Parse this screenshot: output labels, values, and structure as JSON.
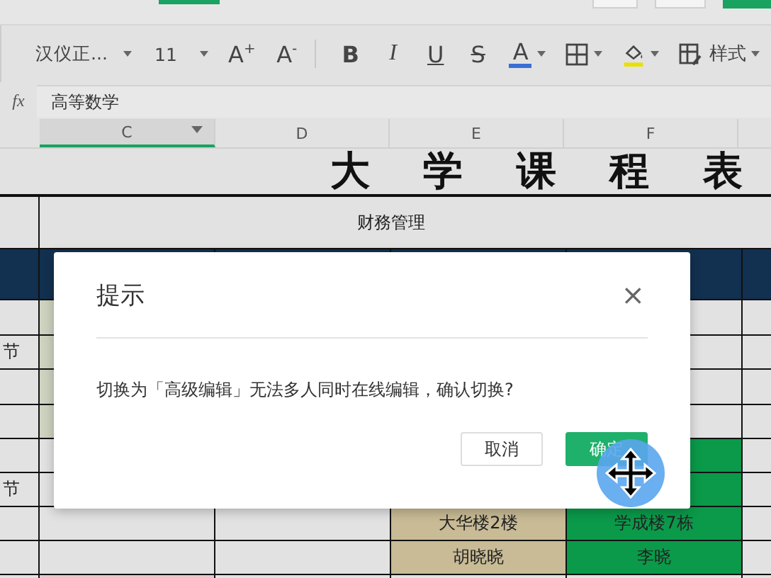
{
  "toolbar": [
    {
      "kind": "font",
      "label": "汉仪正..."
    },
    {
      "kind": "size",
      "label": "11"
    },
    {
      "kind": "grow",
      "label": "A$^{+}$"
    },
    {
      "kind": "shrink",
      "label": "A$^{-}$"
    },
    {
      "kind": "bold",
      "label": "B"
    },
    {
      "kind": "italic",
      "label": "I"
    },
    {
      "kind": "underline",
      "label": "U"
    },
    {
      "kind": "strike",
      "label": "S"
    },
    {
      "kind": "font-color",
      "label": "A",
      "color": "#3b6fd6"
    },
    {
      "kind": "borders"
    },
    {
      "kind": "fill",
      "color": "#e8e000"
    },
    {
      "kind": "styles",
      "label": "样式"
    }
  ],
  "formula_bar": {
    "label": "fx",
    "value": "高等数学"
  },
  "columns": [
    {
      "label": "C",
      "selected": true
    },
    {
      "label": "D",
      "selected": false
    },
    {
      "label": "E",
      "selected": false
    },
    {
      "label": "F",
      "selected": false
    }
  ],
  "sheet": {
    "title": "大 学 课 程 表",
    "subtitle": "财務管理",
    "rows": [
      {
        "cells": [
          {
            "color": "#12304f"
          },
          {
            "color": "#12304f"
          },
          {
            "color": "#12304f"
          },
          {
            "color": "#12304f"
          },
          {
            "color": "#12304f"
          },
          {
            "color": "#12304f"
          }
        ]
      },
      {
        "cells": [
          {},
          {
            "color": "#cdd3bf"
          },
          {},
          {},
          {},
          {}
        ]
      },
      {
        "cells": [
          {
            "text": "节"
          },
          {
            "color": "#cdd3bf"
          },
          {},
          {},
          {},
          {}
        ]
      },
      {
        "cells": [
          {},
          {
            "color": "#cdd3bf"
          },
          {},
          {},
          {},
          {}
        ]
      },
      {
        "cells": [
          {},
          {
            "color": "#cdd3bf"
          },
          {},
          {},
          {},
          {}
        ]
      },
      {
        "cells": [
          {},
          {},
          {},
          {},
          {
            "color": "#0a9a4a"
          },
          {}
        ]
      },
      {
        "cells": [
          {
            "text": "节"
          },
          {},
          {},
          {},
          {
            "color": "#0a9a4a"
          },
          {}
        ]
      },
      {
        "cells": [
          {},
          {},
          {},
          {
            "color": "#c8bb95",
            "text": "大华楼2楼"
          },
          {
            "color": "#0a9a4a",
            "text": "学成楼7栋"
          },
          {}
        ]
      },
      {
        "cells": [
          {},
          {},
          {},
          {
            "color": "#c8bb95",
            "text": "胡晓晓"
          },
          {
            "color": "#0a9a4a",
            "text": "李晓"
          },
          {}
        ]
      },
      {
        "cells": [
          {},
          {
            "color": "#e8c8cc"
          },
          {},
          {},
          {},
          {}
        ]
      }
    ]
  },
  "dialog": {
    "title": "提示",
    "close": "×",
    "message": "切换为「高级编辑」无法多人同时在线编辑，确认切换?",
    "buttons": [
      {
        "label": "取消",
        "kind": "secondary"
      },
      {
        "label": "确定",
        "kind": "primary"
      }
    ]
  }
}
